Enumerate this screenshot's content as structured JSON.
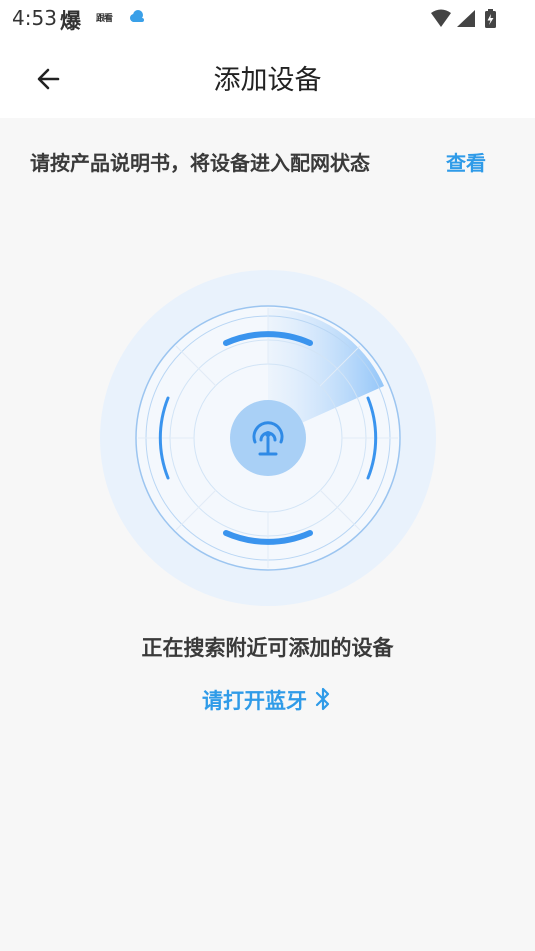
{
  "status_bar": {
    "time": "4:53",
    "app_icon_text": "爆",
    "news_icon_text": "跟看",
    "weather_icon": "cloud-icon",
    "wifi_icon": "wifi-icon",
    "signal_icon": "signal-icon",
    "battery_icon": "battery-charging-icon"
  },
  "header": {
    "back_icon": "back-arrow-icon",
    "title": "添加设备"
  },
  "instruction": {
    "text": "请按产品说明书，将设备进入配网状态",
    "link_label": "查看"
  },
  "radar": {
    "center_icon": "broadcast-icon"
  },
  "search": {
    "status_text": "正在搜索附近可添加的设备"
  },
  "bluetooth": {
    "label": "请打开蓝牙",
    "icon": "bluetooth-icon"
  },
  "colors": {
    "accent": "#2f9be8",
    "background": "#f7f7f7",
    "radar_blue": "#3a94ee"
  }
}
